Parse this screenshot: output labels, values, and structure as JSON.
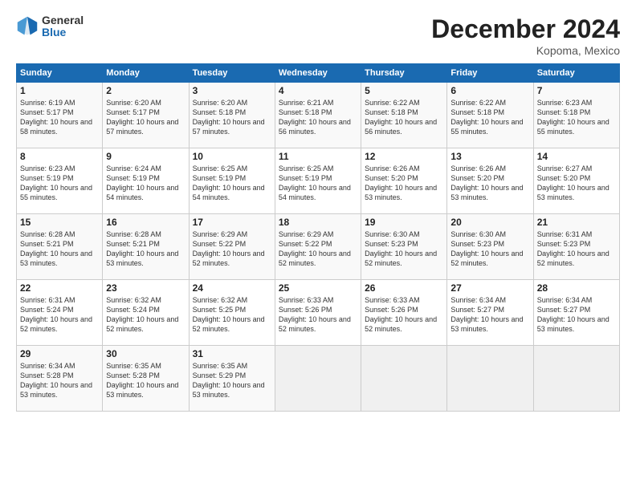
{
  "logo": {
    "general": "General",
    "blue": "Blue"
  },
  "title": {
    "month": "December 2024",
    "location": "Kopoma, Mexico"
  },
  "calendar": {
    "headers": [
      "Sunday",
      "Monday",
      "Tuesday",
      "Wednesday",
      "Thursday",
      "Friday",
      "Saturday"
    ],
    "weeks": [
      [
        {
          "day": "",
          "empty": true
        },
        {
          "day": "",
          "empty": true
        },
        {
          "day": "",
          "empty": true
        },
        {
          "day": "",
          "empty": true
        },
        {
          "day": "",
          "empty": true
        },
        {
          "day": "",
          "empty": true
        },
        {
          "day": "",
          "empty": true
        }
      ],
      [
        {
          "day": "1",
          "sunrise": "6:19 AM",
          "sunset": "5:17 PM",
          "daylight": "10 hours and 58 minutes."
        },
        {
          "day": "2",
          "sunrise": "6:20 AM",
          "sunset": "5:17 PM",
          "daylight": "10 hours and 57 minutes."
        },
        {
          "day": "3",
          "sunrise": "6:20 AM",
          "sunset": "5:18 PM",
          "daylight": "10 hours and 57 minutes."
        },
        {
          "day": "4",
          "sunrise": "6:21 AM",
          "sunset": "5:18 PM",
          "daylight": "10 hours and 56 minutes."
        },
        {
          "day": "5",
          "sunrise": "6:22 AM",
          "sunset": "5:18 PM",
          "daylight": "10 hours and 56 minutes."
        },
        {
          "day": "6",
          "sunrise": "6:22 AM",
          "sunset": "5:18 PM",
          "daylight": "10 hours and 55 minutes."
        },
        {
          "day": "7",
          "sunrise": "6:23 AM",
          "sunset": "5:18 PM",
          "daylight": "10 hours and 55 minutes."
        }
      ],
      [
        {
          "day": "8",
          "sunrise": "6:23 AM",
          "sunset": "5:19 PM",
          "daylight": "10 hours and 55 minutes."
        },
        {
          "day": "9",
          "sunrise": "6:24 AM",
          "sunset": "5:19 PM",
          "daylight": "10 hours and 54 minutes."
        },
        {
          "day": "10",
          "sunrise": "6:25 AM",
          "sunset": "5:19 PM",
          "daylight": "10 hours and 54 minutes."
        },
        {
          "day": "11",
          "sunrise": "6:25 AM",
          "sunset": "5:19 PM",
          "daylight": "10 hours and 54 minutes."
        },
        {
          "day": "12",
          "sunrise": "6:26 AM",
          "sunset": "5:20 PM",
          "daylight": "10 hours and 53 minutes."
        },
        {
          "day": "13",
          "sunrise": "6:26 AM",
          "sunset": "5:20 PM",
          "daylight": "10 hours and 53 minutes."
        },
        {
          "day": "14",
          "sunrise": "6:27 AM",
          "sunset": "5:20 PM",
          "daylight": "10 hours and 53 minutes."
        }
      ],
      [
        {
          "day": "15",
          "sunrise": "6:28 AM",
          "sunset": "5:21 PM",
          "daylight": "10 hours and 53 minutes."
        },
        {
          "day": "16",
          "sunrise": "6:28 AM",
          "sunset": "5:21 PM",
          "daylight": "10 hours and 53 minutes."
        },
        {
          "day": "17",
          "sunrise": "6:29 AM",
          "sunset": "5:22 PM",
          "daylight": "10 hours and 52 minutes."
        },
        {
          "day": "18",
          "sunrise": "6:29 AM",
          "sunset": "5:22 PM",
          "daylight": "10 hours and 52 minutes."
        },
        {
          "day": "19",
          "sunrise": "6:30 AM",
          "sunset": "5:23 PM",
          "daylight": "10 hours and 52 minutes."
        },
        {
          "day": "20",
          "sunrise": "6:30 AM",
          "sunset": "5:23 PM",
          "daylight": "10 hours and 52 minutes."
        },
        {
          "day": "21",
          "sunrise": "6:31 AM",
          "sunset": "5:23 PM",
          "daylight": "10 hours and 52 minutes."
        }
      ],
      [
        {
          "day": "22",
          "sunrise": "6:31 AM",
          "sunset": "5:24 PM",
          "daylight": "10 hours and 52 minutes."
        },
        {
          "day": "23",
          "sunrise": "6:32 AM",
          "sunset": "5:24 PM",
          "daylight": "10 hours and 52 minutes."
        },
        {
          "day": "24",
          "sunrise": "6:32 AM",
          "sunset": "5:25 PM",
          "daylight": "10 hours and 52 minutes."
        },
        {
          "day": "25",
          "sunrise": "6:33 AM",
          "sunset": "5:26 PM",
          "daylight": "10 hours and 52 minutes."
        },
        {
          "day": "26",
          "sunrise": "6:33 AM",
          "sunset": "5:26 PM",
          "daylight": "10 hours and 52 minutes."
        },
        {
          "day": "27",
          "sunrise": "6:34 AM",
          "sunset": "5:27 PM",
          "daylight": "10 hours and 53 minutes."
        },
        {
          "day": "28",
          "sunrise": "6:34 AM",
          "sunset": "5:27 PM",
          "daylight": "10 hours and 53 minutes."
        }
      ],
      [
        {
          "day": "29",
          "sunrise": "6:34 AM",
          "sunset": "5:28 PM",
          "daylight": "10 hours and 53 minutes."
        },
        {
          "day": "30",
          "sunrise": "6:35 AM",
          "sunset": "5:28 PM",
          "daylight": "10 hours and 53 minutes."
        },
        {
          "day": "31",
          "sunrise": "6:35 AM",
          "sunset": "5:29 PM",
          "daylight": "10 hours and 53 minutes."
        },
        {
          "day": "",
          "empty": true
        },
        {
          "day": "",
          "empty": true
        },
        {
          "day": "",
          "empty": true
        },
        {
          "day": "",
          "empty": true
        }
      ]
    ]
  }
}
